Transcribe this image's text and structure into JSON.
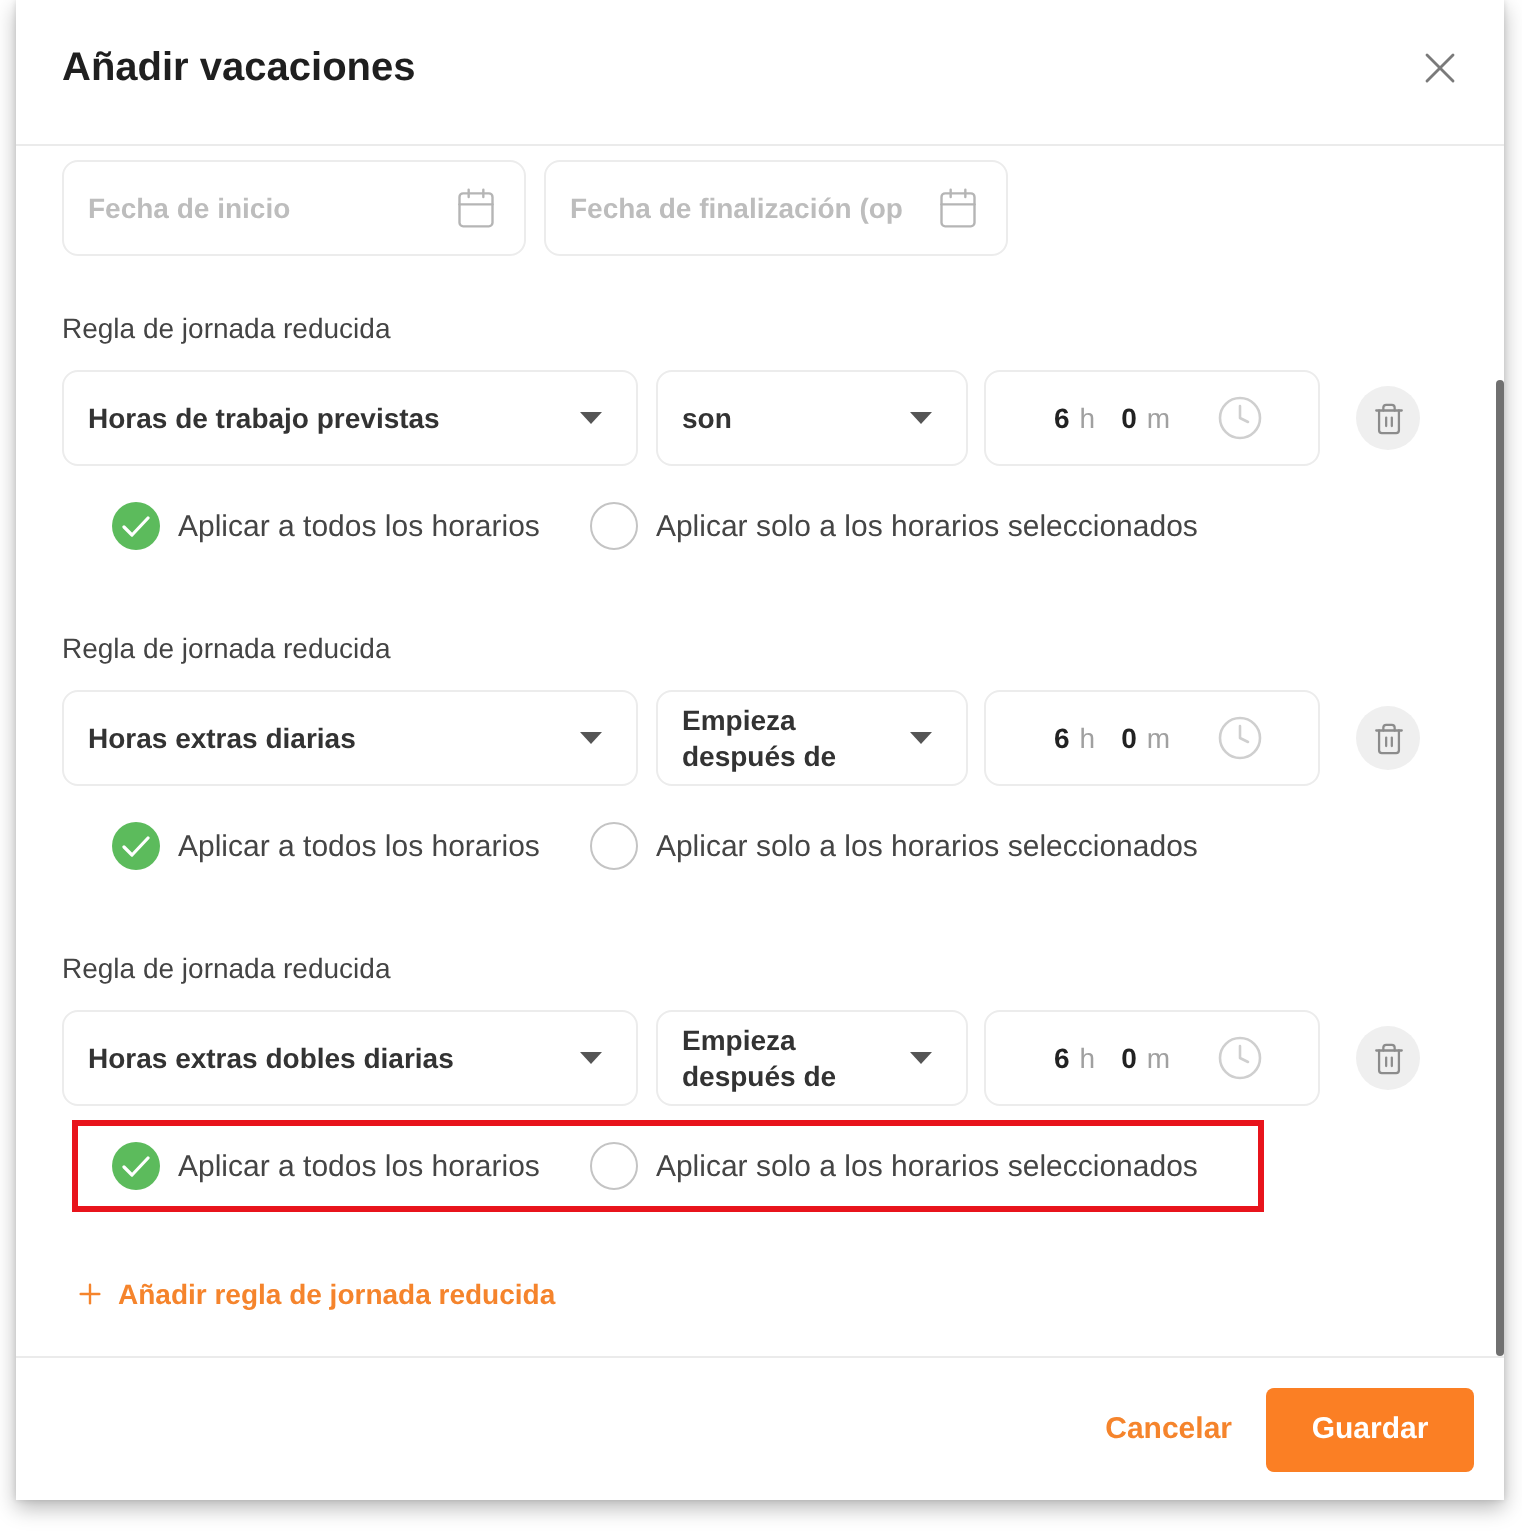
{
  "dialog": {
    "title": "Añadir vacaciones"
  },
  "date_fields": [
    {
      "placeholder": "Fecha de inicio"
    },
    {
      "placeholder": "Fecha de finalización (op"
    }
  ],
  "rules": [
    {
      "label": "Regla de jornada reducida",
      "metric": "Horas de trabajo previstas",
      "condition": "son",
      "hours": "6",
      "hours_unit": "h",
      "minutes": "0",
      "minutes_unit": "m",
      "highlighted": false,
      "options": [
        {
          "label": "Aplicar a todos los horarios",
          "selected": true
        },
        {
          "label": "Aplicar solo a los horarios seleccionados",
          "selected": false
        }
      ]
    },
    {
      "label": "Regla de jornada reducida",
      "metric": "Horas extras diarias",
      "condition": "Empieza después de",
      "hours": "6",
      "hours_unit": "h",
      "minutes": "0",
      "minutes_unit": "m",
      "highlighted": false,
      "options": [
        {
          "label": "Aplicar a todos los horarios",
          "selected": true
        },
        {
          "label": "Aplicar solo a los horarios seleccionados",
          "selected": false
        }
      ]
    },
    {
      "label": "Regla de jornada reducida",
      "metric": "Horas extras dobles diarias",
      "condition": "Empieza después de",
      "hours": "6",
      "hours_unit": "h",
      "minutes": "0",
      "minutes_unit": "m",
      "highlighted": true,
      "options": [
        {
          "label": "Aplicar a todos los horarios",
          "selected": true
        },
        {
          "label": "Aplicar solo a los horarios seleccionados",
          "selected": false
        }
      ]
    }
  ],
  "add_rule": {
    "label": "Añadir regla de jornada reducida"
  },
  "footer": {
    "buttons": [
      {
        "label": "Cancelar",
        "kind": "text"
      },
      {
        "label": "Guardar",
        "kind": "primary"
      }
    ]
  }
}
